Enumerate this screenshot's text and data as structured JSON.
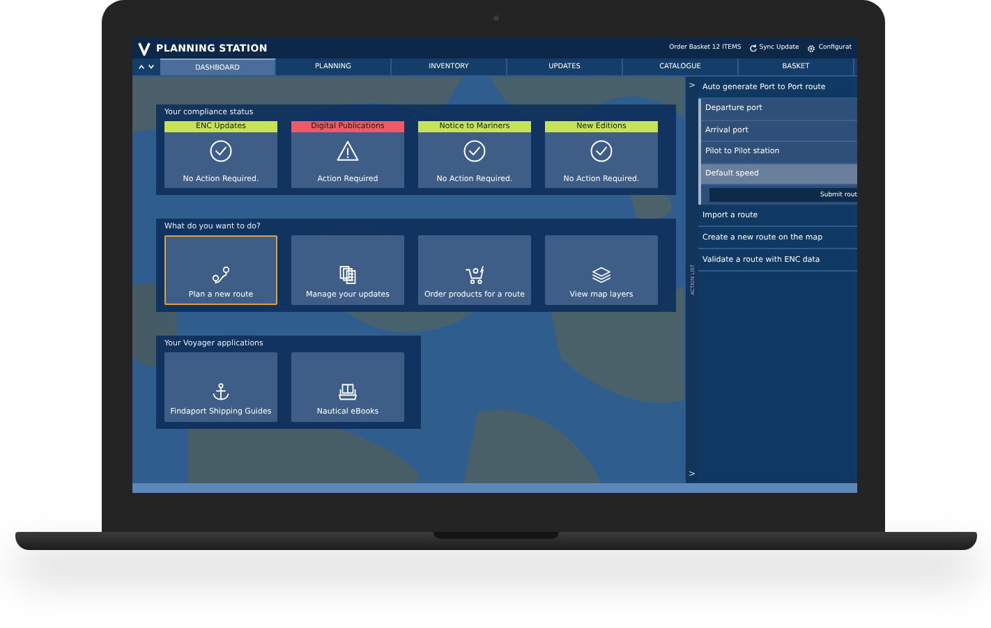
{
  "header": {
    "title": "PLANNING STATION",
    "order_basket": "Order Basket 12 ITEMS",
    "sync": "Sync Update",
    "configure": "Configurat"
  },
  "tabs": [
    {
      "label": "DASHBOARD",
      "selected": true
    },
    {
      "label": "PLANNING",
      "selected": false
    },
    {
      "label": "INVENTORY",
      "selected": false
    },
    {
      "label": "UPDATES",
      "selected": false
    },
    {
      "label": "CATALOGUE",
      "selected": false
    },
    {
      "label": "BASKET",
      "selected": false
    }
  ],
  "compliance": {
    "title": "Your compliance status",
    "items": [
      {
        "title": "ENC Updates",
        "status": "No Action Required.",
        "kind": "ok"
      },
      {
        "title": "Digital Publications",
        "status": "Action Required",
        "kind": "alert"
      },
      {
        "title": "Notice to Mariners",
        "status": "No Action Required.",
        "kind": "ok"
      },
      {
        "title": "New Editions",
        "status": "No Action Required.",
        "kind": "ok"
      }
    ]
  },
  "actions": {
    "title": "What do you want to do?",
    "items": [
      {
        "label": "Plan a new route",
        "kind": "route",
        "selected": true
      },
      {
        "label": "Manage your updates",
        "kind": "documents",
        "selected": false
      },
      {
        "label": "Order products for a route",
        "kind": "cart",
        "selected": false
      },
      {
        "label": "View map layers",
        "kind": "layers",
        "selected": false
      }
    ]
  },
  "applications": {
    "title": "Your Voyager applications",
    "items": [
      {
        "label": "Findaport Shipping Guides",
        "kind": "anchor"
      },
      {
        "label": "Nautical eBooks",
        "kind": "book"
      }
    ]
  },
  "action_list": {
    "label": "ACTION LIST",
    "chevrons": [
      ">",
      ">"
    ],
    "route_generator": {
      "title": "Auto generate Port to Port route",
      "expanded": true,
      "fields": [
        {
          "label": "Departure port",
          "selected": false
        },
        {
          "label": "Arrival port",
          "selected": false
        },
        {
          "label": "Pilot to Pilot station",
          "selected": false
        },
        {
          "label": "Default speed",
          "selected": true
        }
      ],
      "submit": "Submit rout"
    },
    "items": [
      "Import a route",
      "Create a new route on the map",
      "Validate a route with ENC data"
    ]
  }
}
